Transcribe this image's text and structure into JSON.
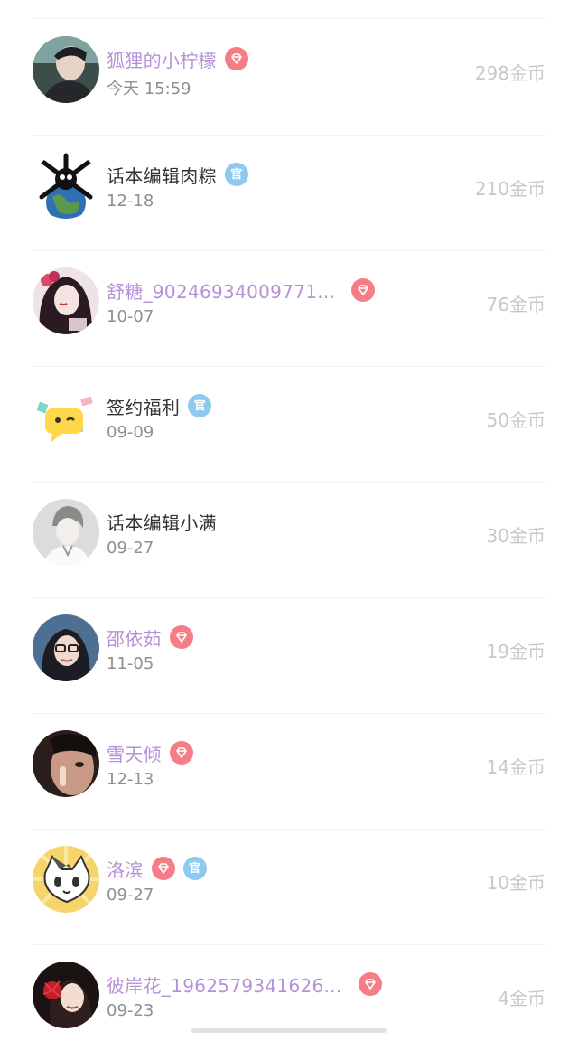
{
  "unit_suffix": "金币",
  "rows": [
    {
      "name": "狐狸的小柠檬",
      "date": "今天 15:59",
      "coins": "298金币",
      "vip": true,
      "official": false,
      "avatar": "photo-man-dark"
    },
    {
      "name": "话本编辑肉粽",
      "date": "12-18",
      "coins": "210金币",
      "vip": false,
      "official": true,
      "avatar": "cartoon-skull-earth"
    },
    {
      "name": "舒糖_90246934009771...",
      "date": "10-07",
      "coins": "76金币",
      "vip": true,
      "official": false,
      "avatar": "anime-girl-red"
    },
    {
      "name": "签约福利",
      "date": "09-09",
      "coins": "50金币",
      "vip": false,
      "official": true,
      "avatar": "yellow-chat-bubble"
    },
    {
      "name": "话本编辑小满",
      "date": "09-27",
      "coins": "30金币",
      "vip": false,
      "official": false,
      "avatar": "anime-doctor-grey"
    },
    {
      "name": "邵依茹",
      "date": "11-05",
      "coins": "19金币",
      "vip": true,
      "official": false,
      "avatar": "photo-woman-glasses"
    },
    {
      "name": "雪天倾",
      "date": "12-13",
      "coins": "14金币",
      "vip": true,
      "official": false,
      "avatar": "photo-man-close"
    },
    {
      "name": "洛滨",
      "date": "09-27",
      "coins": "10金币",
      "vip": true,
      "official": true,
      "avatar": "cartoon-cat"
    },
    {
      "name": "彼岸花_1962579341626...",
      "date": "09-23",
      "coins": "4金币",
      "vip": true,
      "official": false,
      "avatar": "photo-girl-red-flower"
    }
  ],
  "official_badge_text": "官",
  "colors": {
    "vip_name": "#b691d6",
    "vip_badge": "#f57d86",
    "official_badge": "#8ec9f0",
    "coins": "#c8c8cc",
    "date": "#8e8e93"
  }
}
